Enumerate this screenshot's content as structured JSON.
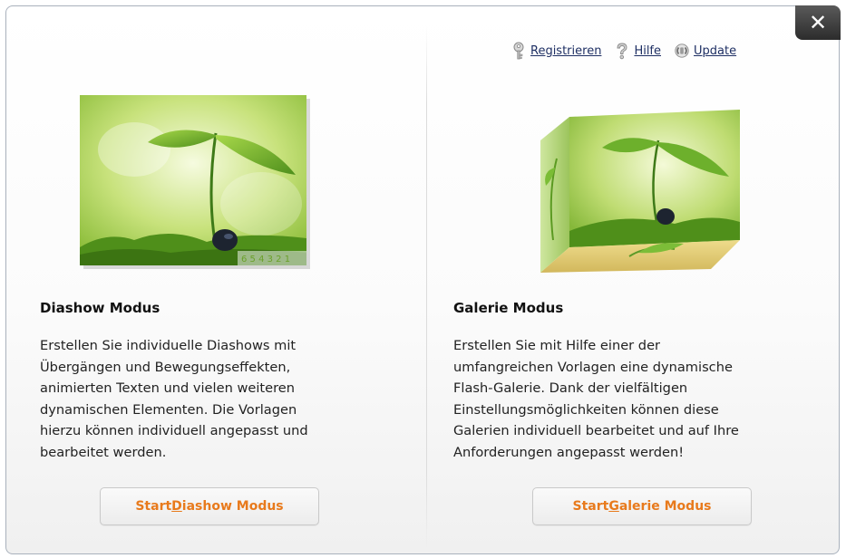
{
  "close": {
    "label": "✕"
  },
  "toplinks": {
    "register": "Registrieren",
    "help": "Hilfe",
    "update": "Update"
  },
  "left": {
    "title": "Diashow Modus",
    "text": "Erstellen Sie individuelle Diashows mit\nÜbergängen und Bewegungseffekten,\nanimierten Texten und vielen weiteren\ndynamischen Elementen. Die Vorlagen\nhierzu können individuell angepasst und\nbearbeitet werden.",
    "button_prefix": "Start ",
    "button_underline": "D",
    "button_rest": "iashow Modus",
    "counter": "6 5 4 3 2 1"
  },
  "right": {
    "title": "Galerie Modus",
    "text": "Erstellen Sie mit Hilfe einer der\numfangreichen Vorlagen eine dynamische\nFlash-Galerie. Dank der vielfältigen\nEinstellungsmöglichkeiten können diese\nGalerien individuell bearbeitet und auf Ihre\nAnforderungen angepasst werden!",
    "button_prefix": "Start ",
    "button_underline": "G",
    "button_rest": "alerie Modus"
  },
  "colors": {
    "accent": "#e87a1c",
    "link": "#1e2f63",
    "close_bg": "#2c2c2c"
  }
}
